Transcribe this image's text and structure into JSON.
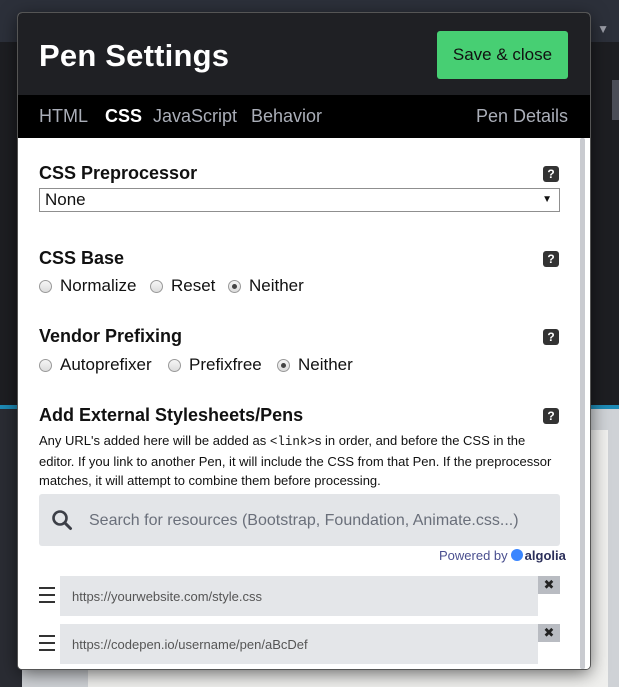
{
  "modal": {
    "title": "Pen Settings",
    "save_label": "Save & close"
  },
  "tabs": {
    "html": "HTML",
    "css": "CSS",
    "javascript": "JavaScript",
    "behavior": "Behavior",
    "pen_details": "Pen Details",
    "active": "CSS"
  },
  "help_glyph": "?",
  "preprocessor": {
    "title": "CSS Preprocessor",
    "selected": "None"
  },
  "css_base": {
    "title": "CSS Base",
    "options": [
      "Normalize",
      "Reset",
      "Neither"
    ],
    "selected": "Neither"
  },
  "vendor_prefixing": {
    "title": "Vendor Prefixing",
    "options": [
      "Autoprefixer",
      "Prefixfree",
      "Neither"
    ],
    "selected": "Neither"
  },
  "external": {
    "title": "Add External Stylesheets/Pens",
    "desc_before": "Any URL's added here will be added as ",
    "desc_code": "<link>",
    "desc_after": "s in order, and before the CSS in the editor. If you link to another Pen, it will include the CSS from that Pen. If the preprocessor matches, it will attempt to combine them before processing.",
    "search_placeholder": "Search for resources (Bootstrap, Foundation, Animate.css...)",
    "powered_by": "Powered by",
    "algolia": "algolia",
    "resources": [
      {
        "placeholder": "https://yourwebsite.com/style.css"
      },
      {
        "placeholder": "https://codepen.io/username/pen/aBcDef"
      }
    ],
    "remove_glyph": "✖"
  },
  "icons": [
    "search-icon",
    "help-icon",
    "drag-handle-icon",
    "remove-icon",
    "chevron-down-icon"
  ],
  "colors": {
    "save_button": "#47cf73",
    "header_bg": "#1f2024",
    "tabs_bg": "#000000"
  }
}
